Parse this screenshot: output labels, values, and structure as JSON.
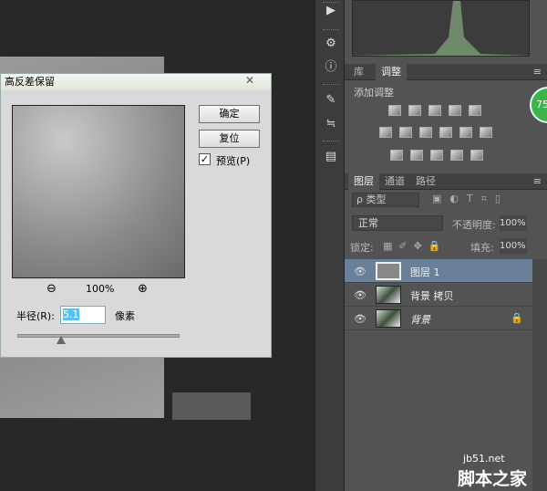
{
  "dialog": {
    "title": "高反差保留",
    "ok": "确定",
    "reset": "复位",
    "preview_label": "预览(P)",
    "preview_checked": true,
    "zoom": "100%",
    "radius_label": "半径(R):",
    "radius_value": "5.1",
    "unit": "像素",
    "slider_fraction": 0.27
  },
  "adjust_tabs": [
    "库",
    "调整"
  ],
  "adjust_title": "添加调整",
  "layer_tabs": [
    "图层",
    "通道",
    "路径"
  ],
  "filter_kind": "ρ 类型",
  "blend_mode": "正常",
  "opacity_label": "不透明度:",
  "opacity": "100%",
  "lock_label": "锁定:",
  "fill_label": "填充:",
  "fill": "100%",
  "layers": [
    {
      "name": "图层 1",
      "selected": true
    },
    {
      "name": "背景 拷贝",
      "selected": false
    },
    {
      "name": "背景",
      "selected": false,
      "locked": true
    }
  ],
  "badge": "75",
  "watermark": {
    "site": "jb51.net",
    "name": "脚本之家"
  }
}
